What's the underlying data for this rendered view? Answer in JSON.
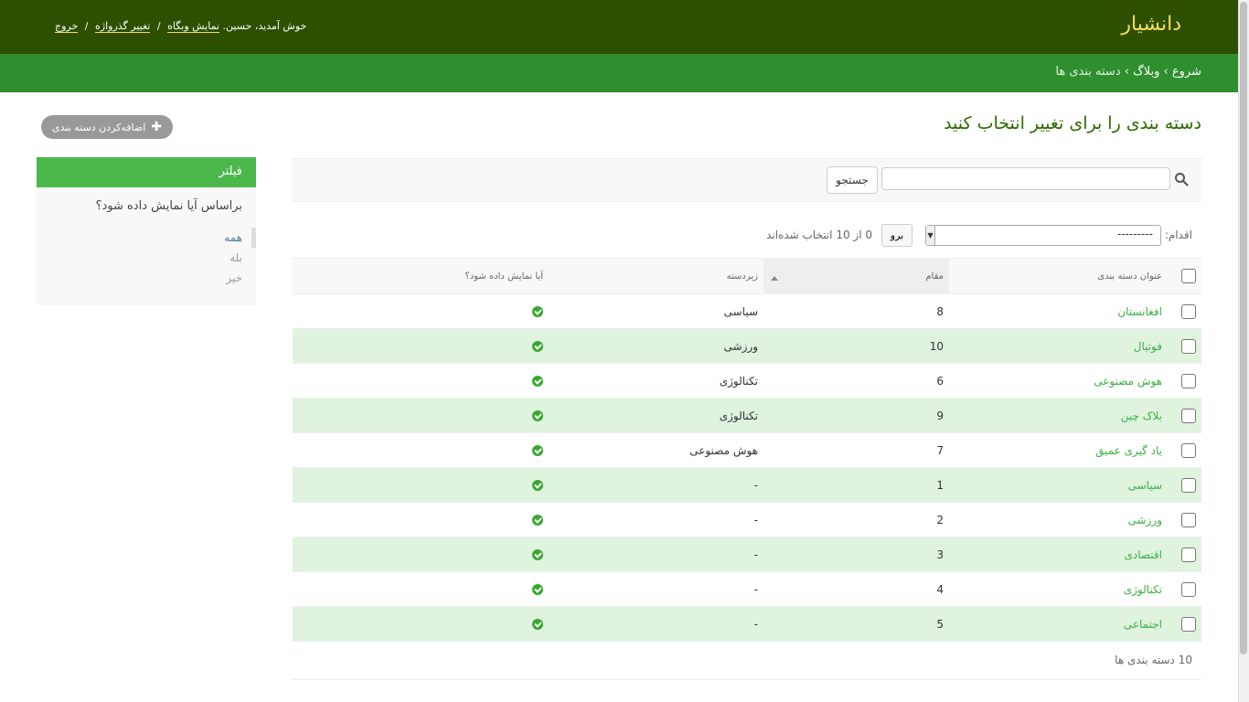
{
  "header": {
    "brand": "دانشیار",
    "welcome": "خوش آمدید، حسین.",
    "view_site": "نمایش وبگاه",
    "change_password": "تغییر گذرواژه",
    "logout": "خروج",
    "sep": "/"
  },
  "breadcrumbs": {
    "home": "شروع",
    "app": "وبلاگ",
    "current": "دسته بندی ها",
    "sep": "›"
  },
  "page": {
    "title": "دسته بندی را برای تغییر انتخاب کنید",
    "add_label": "اضافه‌کردن دسته بندی"
  },
  "filter": {
    "title": "فیلتر",
    "question": "براساس آیا نمایش داده شود؟",
    "options": [
      "همه",
      "بله",
      "خیر"
    ]
  },
  "search": {
    "button": "جستجو",
    "value": ""
  },
  "actions": {
    "label": "اقدام:",
    "selected": "---------",
    "go": "برو",
    "counter": "0 از 10 انتخاب شده‌اند"
  },
  "table": {
    "headers": {
      "title": "عنوان دسته بندی",
      "position": "مقام",
      "parent": "زیردسته",
      "visible": "آیا نمایش داده شود؟"
    },
    "rows": [
      {
        "title": "افغانستان",
        "position": "8",
        "parent": "سیاسی",
        "visible": true
      },
      {
        "title": "فوتبال",
        "position": "10",
        "parent": "ورزشی",
        "visible": true
      },
      {
        "title": "هوش مصنوعی",
        "position": "6",
        "parent": "تکنالوژی",
        "visible": true
      },
      {
        "title": "بلاک چین",
        "position": "9",
        "parent": "تکنالوژی",
        "visible": true
      },
      {
        "title": "یاد گیری عمیق",
        "position": "7",
        "parent": "هوش مصنوعی",
        "visible": true
      },
      {
        "title": "سیاسی",
        "position": "1",
        "parent": "-",
        "visible": true
      },
      {
        "title": "ورزشی",
        "position": "2",
        "parent": "-",
        "visible": true
      },
      {
        "title": "اقتصادی",
        "position": "3",
        "parent": "-",
        "visible": true
      },
      {
        "title": "تکنالوژی",
        "position": "4",
        "parent": "-",
        "visible": true
      },
      {
        "title": "اجتماعی",
        "position": "5",
        "parent": "-",
        "visible": true
      }
    ]
  },
  "paginator": "10 دسته بندی ها",
  "colors": {
    "header_bg": "#2d5000",
    "brand": "#f5dd5d",
    "breadcrumb_bg": "#2f8f2f",
    "link": "#3cb043",
    "alt_row": "#dff3df",
    "filter_head": "#4cb84c"
  }
}
